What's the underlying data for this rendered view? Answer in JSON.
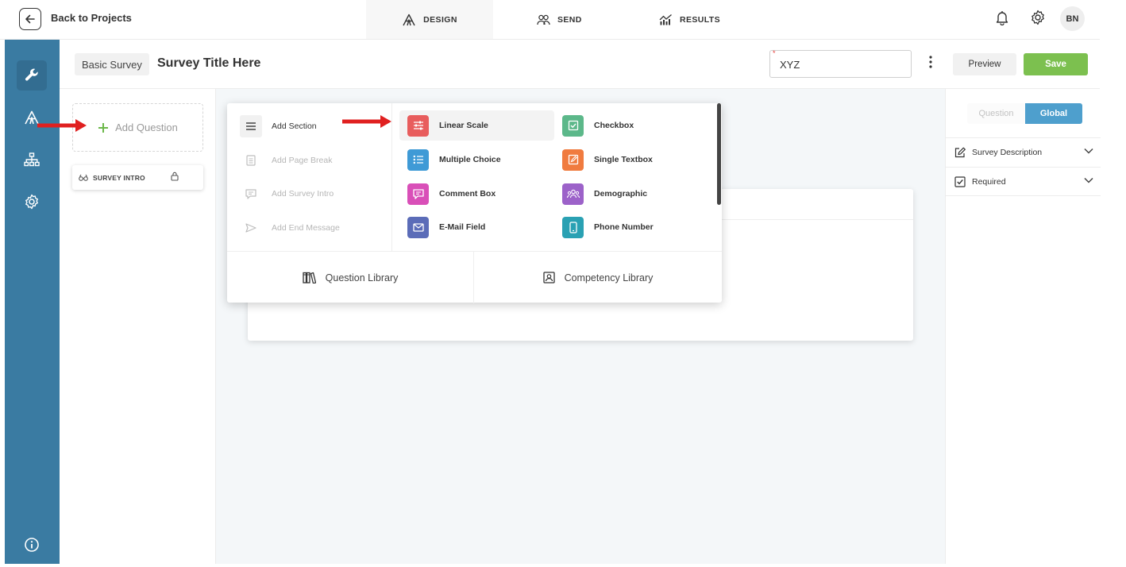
{
  "topbar": {
    "back_label": "Back to Projects",
    "tabs": [
      {
        "label": "DESIGN",
        "icon": "design-icon"
      },
      {
        "label": "SEND",
        "icon": "people-icon"
      },
      {
        "label": "RESULTS",
        "icon": "results-chart-icon"
      }
    ],
    "avatar_initials": "BN"
  },
  "rail": {
    "items": [
      "tools-icon",
      "design-icon",
      "hierarchy-icon",
      "settings-icon",
      "info-icon"
    ],
    "color": "#3a7ba2"
  },
  "header": {
    "survey_type": "Basic Survey",
    "survey_title": "Survey Title Here",
    "name_field_value": "XYZ",
    "name_field_required_mark": "*",
    "preview_label": "Preview",
    "save_label": "Save",
    "save_color": "#7cc04f"
  },
  "question_list": {
    "add_question_label": "Add Question",
    "intro_label": "SURVEY INTRO"
  },
  "menu": {
    "section_items": [
      {
        "label": "Add Section",
        "enabled": true
      },
      {
        "label": "Add Page Break",
        "enabled": false
      },
      {
        "label": "Add Survey Intro",
        "enabled": false
      },
      {
        "label": "Add End Message",
        "enabled": false
      }
    ],
    "question_types": [
      {
        "label": "Linear Scale",
        "color": "#e85d5d",
        "icon": "sliders-icon"
      },
      {
        "label": "Checkbox",
        "color": "#5cb88a",
        "icon": "checkbox-icon"
      },
      {
        "label": "Multiple Choice",
        "color": "#3f9ad6",
        "icon": "list-icon"
      },
      {
        "label": "Single Textbox",
        "color": "#f07b3f",
        "icon": "edit-icon"
      },
      {
        "label": "Comment Box",
        "color": "#d94fb8",
        "icon": "comment-icon"
      },
      {
        "label": "Demographic",
        "color": "#9c62c9",
        "icon": "people-group-icon"
      },
      {
        "label": "E-Mail Field",
        "color": "#5b6cb8",
        "icon": "mail-icon"
      },
      {
        "label": "Phone Number",
        "color": "#2aa1b3",
        "icon": "phone-icon"
      }
    ],
    "libraries": [
      {
        "label": "Question Library",
        "icon": "books-icon"
      },
      {
        "label": "Competency Library",
        "icon": "portrait-icon"
      }
    ]
  },
  "right_panel": {
    "segment_question": "Question",
    "segment_global": "Global",
    "accordions": [
      {
        "label": "Survey Description",
        "icon": "edit-icon"
      },
      {
        "label": "Required",
        "icon": "checkbox-icon"
      }
    ]
  },
  "annotation": {
    "arrow_color": "#e02020"
  }
}
